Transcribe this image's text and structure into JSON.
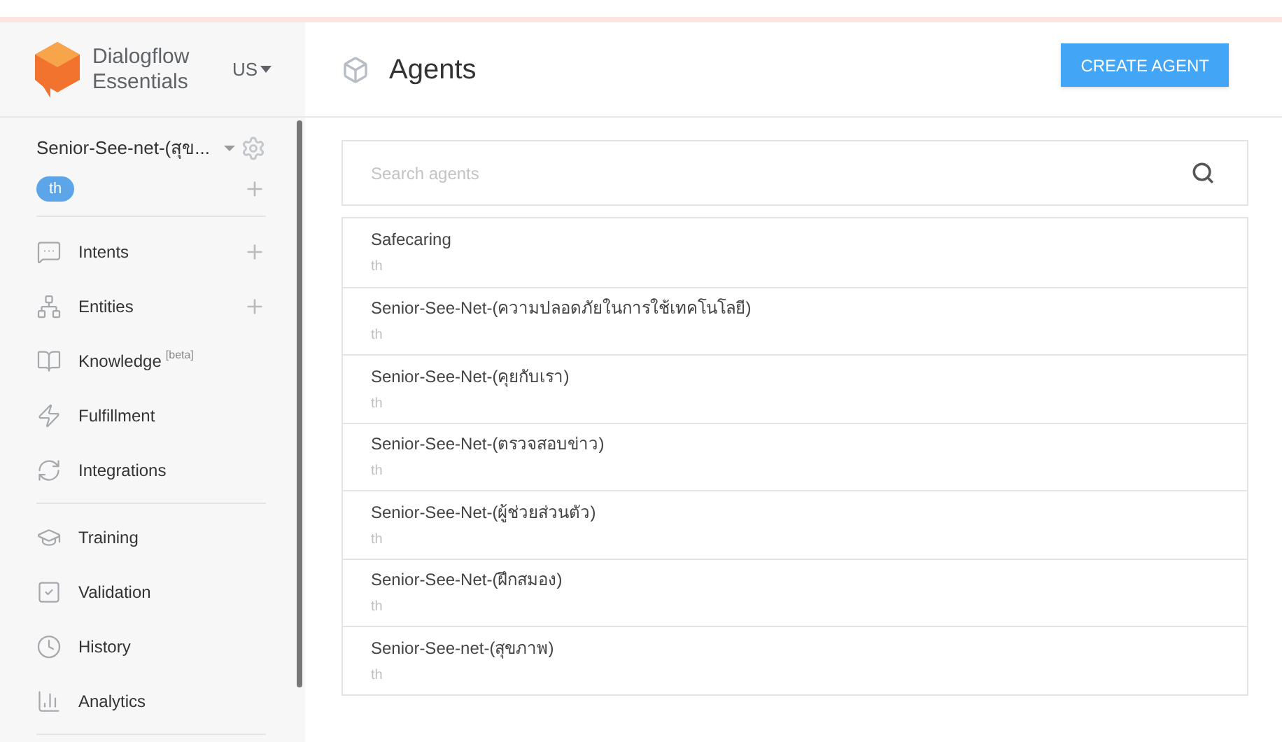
{
  "brand": {
    "line1": "Dialogflow",
    "line2": "Essentials",
    "region": "US"
  },
  "agent_selector": {
    "name": "Senior-See-net-(สุข...",
    "language": "th"
  },
  "nav": [
    {
      "kind": "intents",
      "label": "Intents",
      "add": true
    },
    {
      "kind": "entities",
      "label": "Entities",
      "add": true
    },
    {
      "kind": "knowledge",
      "label": "Knowledge",
      "badge": "[beta]",
      "add": false
    },
    {
      "kind": "fulfillment",
      "label": "Fulfillment",
      "add": false
    },
    {
      "kind": "integrations",
      "label": "Integrations",
      "add": false,
      "divider_after": true
    },
    {
      "kind": "training",
      "label": "Training",
      "add": false
    },
    {
      "kind": "validation",
      "label": "Validation",
      "add": false
    },
    {
      "kind": "history",
      "label": "History",
      "add": false
    },
    {
      "kind": "analytics",
      "label": "Analytics",
      "add": false,
      "divider_after": true
    }
  ],
  "page": {
    "title": "Agents",
    "create_button": "CREATE AGENT"
  },
  "search": {
    "placeholder": "Search agents"
  },
  "agents": [
    {
      "name": "Safecaring",
      "language": "th"
    },
    {
      "name": "Senior-See-Net-(ความปลอดภัยในการใช้เทคโนโลยี)",
      "language": "th"
    },
    {
      "name": "Senior-See-Net-(คุยกับเรา)",
      "language": "th"
    },
    {
      "name": "Senior-See-Net-(ตรวจสอบข่าว)",
      "language": "th"
    },
    {
      "name": "Senior-See-Net-(ผู้ช่วยส่วนตัว)",
      "language": "th"
    },
    {
      "name": "Senior-See-Net-(ฝึกสมอง)",
      "language": "th"
    },
    {
      "name": "Senior-See-net-(สุขภาพ)",
      "language": "th"
    }
  ]
}
